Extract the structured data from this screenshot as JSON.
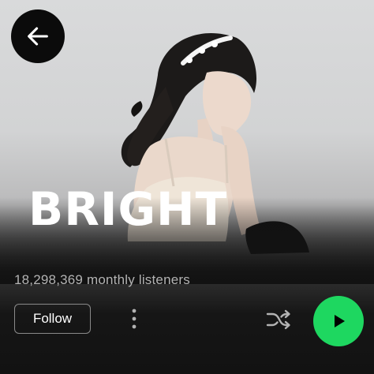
{
  "header": {
    "back_icon": "arrow-left-icon",
    "artist_photo_alt": "artist-photo"
  },
  "artist": {
    "name": "BRIGHT",
    "monthly_listeners": "18,298,369 monthly listeners"
  },
  "actions": {
    "follow_label": "Follow",
    "more_icon": "more-vertical-icon",
    "shuffle_icon": "shuffle-icon",
    "play_icon": "play-icon"
  },
  "colors": {
    "background": "#121212",
    "accent_green": "#1ed760",
    "text_primary": "#ffffff",
    "text_secondary": "#b3b3b3"
  }
}
